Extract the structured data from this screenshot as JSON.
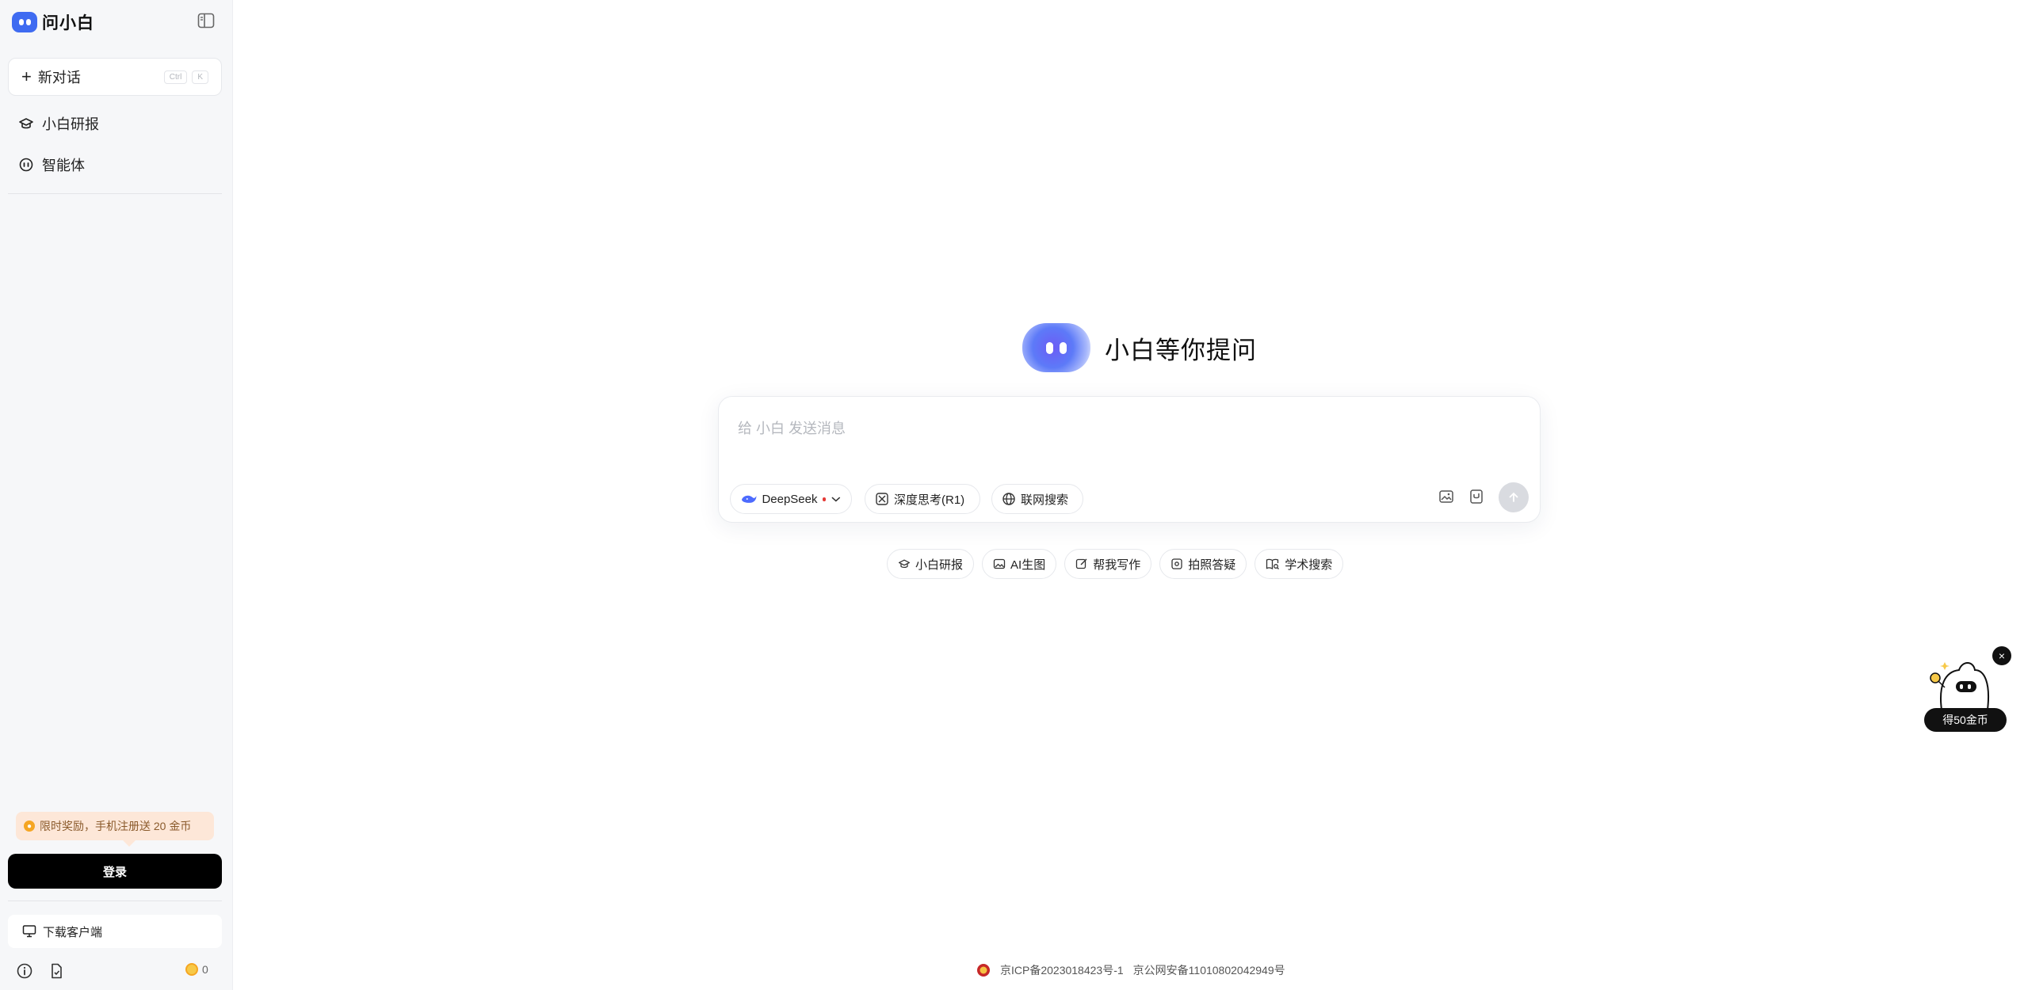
{
  "brand": {
    "name": "问小白"
  },
  "sidebar": {
    "new_chat": {
      "label": "新对话",
      "shortcut": [
        "Ctrl",
        "K"
      ]
    },
    "items": [
      {
        "label": "小白研报",
        "icon": "graduation-cap-icon"
      },
      {
        "label": "智能体",
        "icon": "bot-icon"
      }
    ],
    "promo": {
      "text": "限时奖励，手机注册送 20 金币"
    },
    "login_label": "登录",
    "download_label": "下载客户端",
    "coin_count": "0"
  },
  "main": {
    "hero_title": "小白等你提问",
    "composer": {
      "placeholder": "给 小白 发送消息",
      "model_label": "DeepSeek",
      "deep_think_label": "深度思考(R1)",
      "web_search_label": "联网搜索"
    },
    "quick_actions": [
      {
        "label": "小白研报",
        "icon": "graduation-cap-icon"
      },
      {
        "label": "AI生图",
        "icon": "image-icon"
      },
      {
        "label": "帮我写作",
        "icon": "edit-icon"
      },
      {
        "label": "拍照答疑",
        "icon": "camera-icon"
      },
      {
        "label": "学术搜索",
        "icon": "book-search-icon"
      }
    ],
    "footer": {
      "icp": "京ICP备2023018423号-1",
      "police": "京公网安备11010802042949号"
    }
  },
  "reward": {
    "label": "得50金币"
  },
  "colors": {
    "accent": "#3f6bf1",
    "promo_bg": "#fde7d8",
    "login_bg": "#000000"
  }
}
